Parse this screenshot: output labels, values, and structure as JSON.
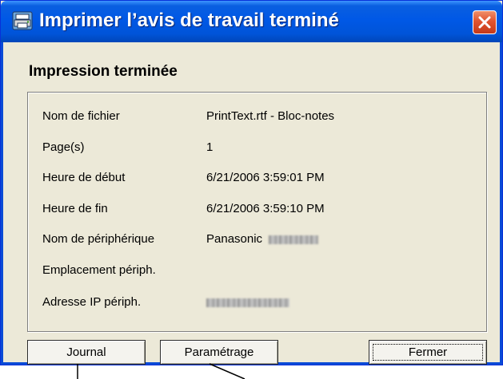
{
  "window": {
    "title": "Imprimer l’avis de travail terminé",
    "titlebar_color": "#0058e6",
    "close_button_color": "#e0532f"
  },
  "heading": "Impression terminée",
  "details": [
    {
      "label": "Nom de fichier",
      "value": "PrintText.rtf - Bloc-notes"
    },
    {
      "label": "Page(s)",
      "value": "1"
    },
    {
      "label": "Heure de début",
      "value": "6/21/2006 3:59:01 PM"
    },
    {
      "label": "Heure de fin",
      "value": "6/21/2006 3:59:10 PM"
    },
    {
      "label": "Nom de périphérique",
      "value": "Panasonic"
    },
    {
      "label": "Emplacement périph.",
      "value": ""
    },
    {
      "label": "Adresse IP périph.",
      "value": ""
    }
  ],
  "buttons": {
    "journal": "Journal",
    "parametrage": "Paramétrage",
    "fermer": "Fermer"
  },
  "icons": {
    "app": "printer-app-icon",
    "close": "close-icon"
  }
}
